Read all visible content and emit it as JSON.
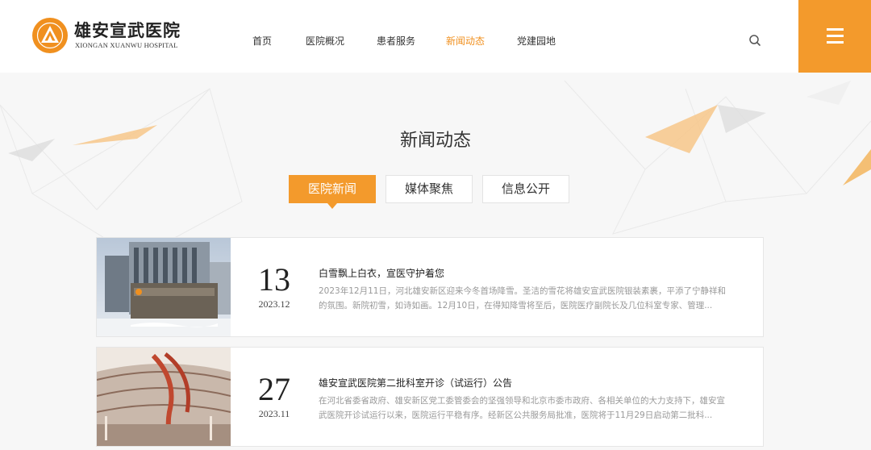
{
  "header": {
    "logo_cn": "雄安宣武医院",
    "logo_en": "XIONGAN XUANWU HOSPITAL",
    "nav": [
      {
        "label": "首页",
        "active": false
      },
      {
        "label": "医院概况",
        "active": false
      },
      {
        "label": "患者服务",
        "active": false
      },
      {
        "label": "新闻动态",
        "active": true
      },
      {
        "label": "党建园地",
        "active": false
      }
    ],
    "search_icon": "search-icon",
    "menu_icon": "hamburger-menu-icon"
  },
  "section": {
    "title": "新闻动态",
    "tabs": [
      {
        "label": "医院新闻",
        "active": true
      },
      {
        "label": "媒体聚焦",
        "active": false
      },
      {
        "label": "信息公开",
        "active": false
      }
    ]
  },
  "news": [
    {
      "day": "13",
      "month": "2023.12",
      "title": "白雪飘上白衣，宣医守护着您",
      "desc": "2023年12月11日，河北雄安新区迎来今冬首场降雪。圣洁的雪花将雄安宣武医院银装素裹，平添了宁静祥和的氛围。新院初雪，如诗如画。12月10日，在得知降雪将至后，医院医疗副院长及几位科室专家、管理...",
      "thumb": "hospital-building-snow-image"
    },
    {
      "day": "27",
      "month": "2023.11",
      "title": "雄安宣武医院第二批科室开诊（试运行）公告",
      "desc": "在河北省委省政府、雄安新区党工委管委会的坚强领导和北京市委市政府、各相关单位的大力支持下，雄安宣武医院开诊试运行以来，医院运行平稳有序。经新区公共服务局批准，医院将于11月29日启动第二批科...",
      "thumb": "hospital-atrium-interior-image"
    }
  ],
  "colors": {
    "accent": "#f39a2c",
    "text": "#333333",
    "muted": "#999999"
  }
}
